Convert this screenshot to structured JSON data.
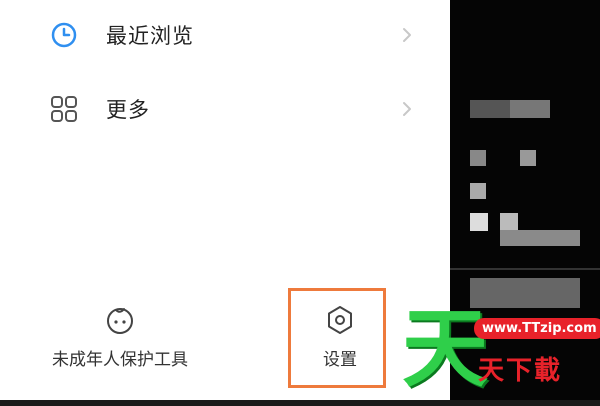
{
  "menu": {
    "items": [
      {
        "label": "最近浏览",
        "icon": "clock-icon"
      },
      {
        "label": "更多",
        "icon": "grid-icon"
      }
    ]
  },
  "bottom": {
    "items": [
      {
        "label": "未成年人保护工具",
        "icon": "child-face-icon"
      },
      {
        "label": "设置",
        "icon": "settings-hexagon-icon"
      }
    ]
  },
  "watermark": {
    "char": "天",
    "url": "www.TTzip.com",
    "text": "天下載"
  },
  "colors": {
    "accent_blue": "#2f8ff0",
    "highlight_orange": "#ee7a3c",
    "watermark_green": "#2fcf4a",
    "watermark_red": "#e8222a"
  }
}
